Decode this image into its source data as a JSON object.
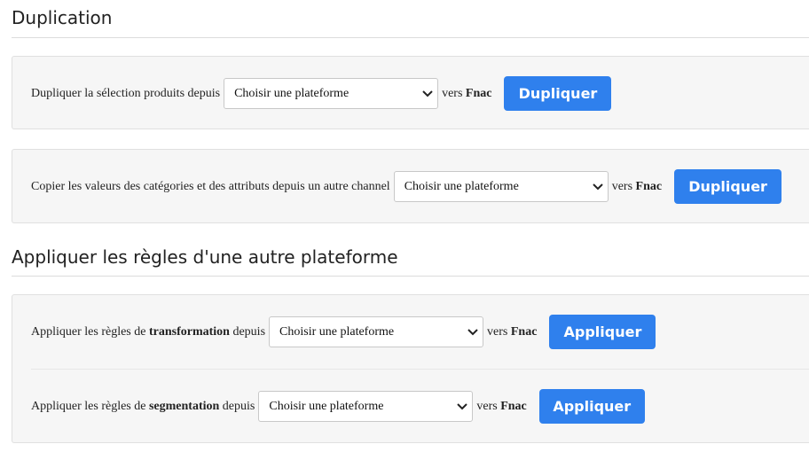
{
  "sections": {
    "duplication": {
      "title": "Duplication"
    },
    "rules": {
      "title": "Appliquer les règles d'une autre plateforme"
    }
  },
  "duplicate_selection": {
    "label": "Dupliquer la sélection produits depuis",
    "select_value": "Choisir une plateforme",
    "vers": "vers",
    "target": "Fnac",
    "button": "Dupliquer"
  },
  "copy_values": {
    "label": "Copier les valeurs des catégories et des attributs depuis un autre channel",
    "select_value": "Choisir une plateforme",
    "vers": "vers",
    "target": "Fnac",
    "button": "Dupliquer"
  },
  "transformation": {
    "label_before": "Appliquer les règles de",
    "label_bold": "transformation",
    "label_after": "depuis",
    "select_value": "Choisir une plateforme",
    "vers": "vers",
    "target": "Fnac",
    "button": "Appliquer"
  },
  "segmentation": {
    "label_before": "Appliquer les règles de",
    "label_bold": "segmentation",
    "label_after": "depuis",
    "select_value": "Choisir une plateforme",
    "vers": "vers",
    "target": "Fnac",
    "button": "Appliquer"
  },
  "icons": {
    "select_arrow": "chevron-down-icon"
  },
  "colors": {
    "button": "#2f80ed",
    "panel": "#f6f6f6"
  }
}
